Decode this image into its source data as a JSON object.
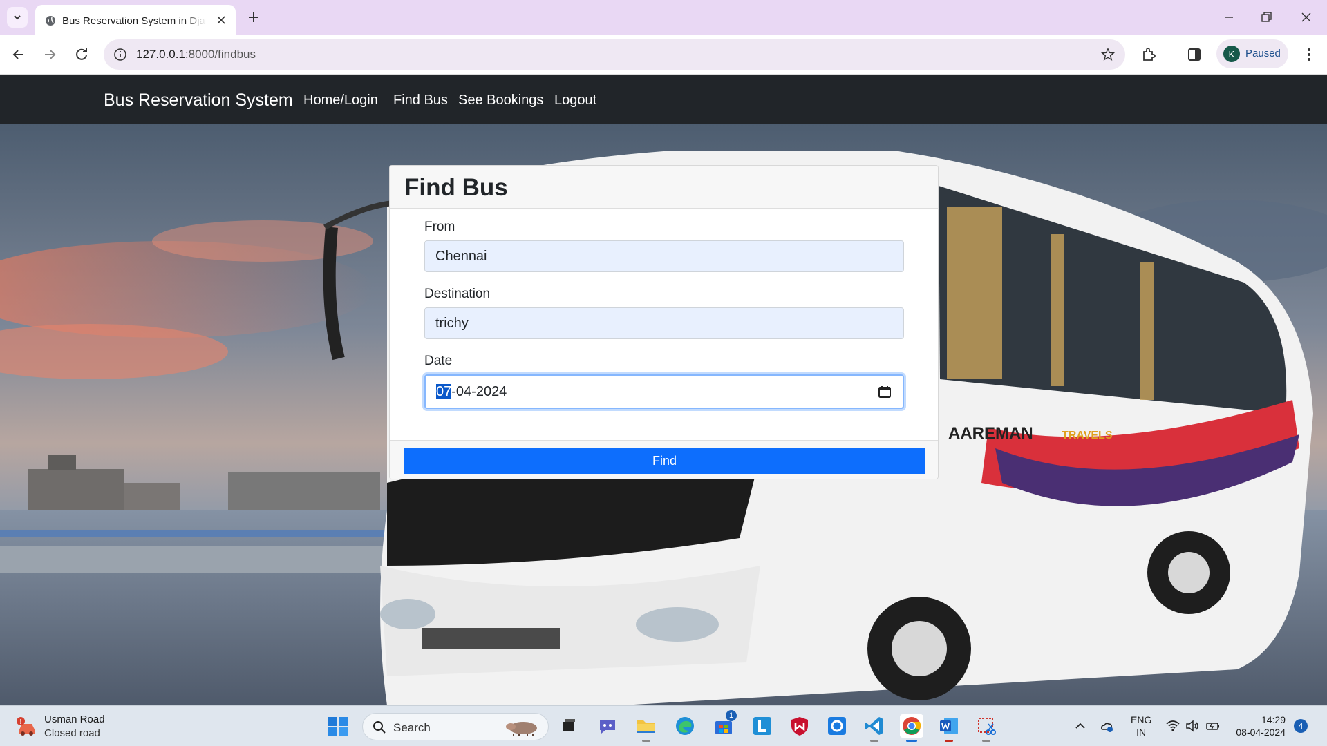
{
  "browser": {
    "tab_title": "Bus Reservation System in Django",
    "url_host": "127.0.0.1",
    "url_path": ":8000/findbus",
    "profile_initial": "K",
    "profile_status": "Paused"
  },
  "navbar": {
    "brand": "Bus Reservation System",
    "links": [
      "Home/Login",
      "Find Bus",
      "See Bookings",
      "Logout"
    ]
  },
  "hero": {
    "bus_brand_text": "AAREMAN TRAVELS"
  },
  "form": {
    "title": "Find Bus",
    "from_label": "From",
    "from_value": "Chennai",
    "destination_label": "Destination",
    "destination_value": "trichy",
    "date_label": "Date",
    "date_day": "07",
    "date_rest": "-04-2024",
    "submit_label": "Find"
  },
  "taskbar": {
    "weather_title": "Usman Road",
    "weather_sub": "Closed road",
    "search_label": "Search",
    "store_badge": "1",
    "lang_top": "ENG",
    "lang_bottom": "IN",
    "time": "14:29",
    "date": "08-04-2024",
    "notification_count": "4"
  },
  "colors": {
    "navbar_bg": "#212529",
    "primary_button": "#0d6efd",
    "autofill_bg": "#e8f0fe",
    "tabstrip_bg": "#e9d8f4"
  }
}
